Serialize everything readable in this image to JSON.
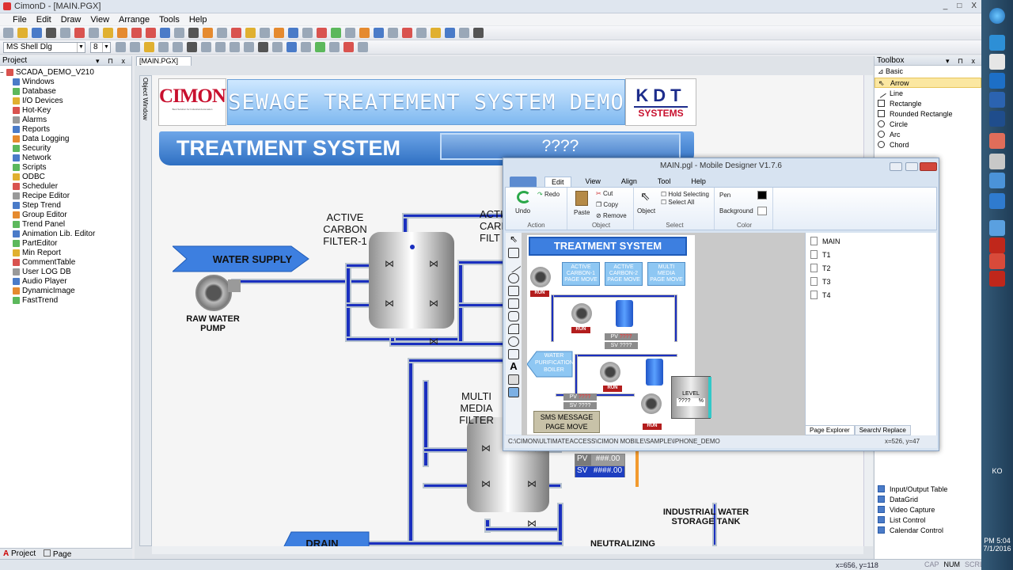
{
  "window": {
    "title": "CimonD - [MAIN.PGX]",
    "controls": [
      "_",
      "□",
      "X"
    ]
  },
  "menu": [
    "File",
    "Edit",
    "Draw",
    "View",
    "Arrange",
    "Tools",
    "Help"
  ],
  "font_toolbar": {
    "font_name": "MS Shell Dlg",
    "font_size": "8"
  },
  "project": {
    "header": "Project",
    "root": "SCADA_DEMO_V210",
    "items": [
      "Windows",
      "Database",
      "I/O Devices",
      "Hot-Key",
      "Alarms",
      "Reports",
      "Data Logging",
      "Security",
      "Network",
      "Scripts",
      "ODBC",
      "Scheduler",
      "Recipe Editor",
      "Step Trend",
      "Group Editor",
      "Trend Panel",
      "Animation Lib. Editor",
      "PartEditor",
      "Min Report",
      "CommentTable",
      "User LOG DB",
      "Audio Player",
      "DynamicImage",
      "FastTrend"
    ],
    "tabs": [
      "Project",
      "Page"
    ]
  },
  "editor": {
    "doc_tab": "[MAIN.PGX]",
    "object_window": "Object Window"
  },
  "scada": {
    "logo_left": "CIMON",
    "logo_left_sub": "Best Solution for Industrial Automation",
    "banner": "SEWAGE TREATEMENT SYSTEM DEMO",
    "logo_right_top": "KDT",
    "logo_right_bottom": "SYSTEMS",
    "treatment_title": "TREATMENT SYSTEM",
    "treatment_value": "????",
    "water_supply": "WATER SUPPLY",
    "raw_pump": "RAW WATER\nPUMP",
    "acf1": "ACTIVE\nCARBON\nFILTER-1",
    "acf2_partial": "ACTI\nCARB\nFILT",
    "multi": "MULTI\nMEDIA\nFILTER",
    "industrial": "INDUSTRIAL WATER\nSTORAGE TANK",
    "neutral": "NEUTRALIZING AGENT",
    "drain": "DRAIN",
    "pv_label": "PV",
    "pv_value": "###.00",
    "sv_label": "SV",
    "sv_value": "####.00"
  },
  "toolbox": {
    "header": "Toolbox",
    "group": "Basic",
    "items": [
      "Arrow",
      "Line",
      "Rectangle",
      "Rounded Rectangle",
      "Circle",
      "Arc",
      "Chord"
    ],
    "bottom_items": [
      "Input/Output Table",
      "DataGrid",
      "Video Capture",
      "List Control",
      "Calendar Control"
    ]
  },
  "status": {
    "coords": "x=656, y=118",
    "caps": "CAP",
    "num": "NUM",
    "scrl": "SCRL"
  },
  "taskbar": {
    "lang": "KO",
    "time": "PM 5:04",
    "date": "7/1/2016"
  },
  "dialog": {
    "title": "MAIN.pgl - Mobile Designer V1.7.6",
    "tabs": [
      "Edit",
      "View",
      "Align",
      "Tool",
      "Help"
    ],
    "ribbon": {
      "undo": "Undo",
      "redo": "Redo",
      "action": "Action",
      "paste": "Paste",
      "cut": "Cut",
      "copy": "Copy",
      "remove": "Remove",
      "object_group": "Object",
      "object_btn": "Object",
      "hold": "Hold Selecting",
      "select_all": "Select All",
      "select": "Select",
      "pen": "Pen",
      "background": "Background",
      "color": "Color"
    },
    "pages": [
      "MAIN",
      "T1",
      "T2",
      "T3",
      "T4"
    ],
    "page_tabs": [
      "Page Explorer",
      "Search/ Replace"
    ],
    "status_path": "C:\\CIMON\\ULTIMATEACCESS\\CIMON MOBILE\\SAMPLE\\IPHONE_DEMO",
    "status_xy": "x=526, y=47",
    "mobile": {
      "title": "TREATMENT SYSTEM",
      "btn1": "ACTIVE\nCARBON-1\nPAGE MOVE",
      "btn2": "ACTIVE\nCARBON-2\nPAGE MOVE",
      "btn3": "MULTI\nMEDIA\nPAGE MOVE",
      "run": "RUN",
      "pv": "PV",
      "sv": "SV",
      "val": "????",
      "boiler": "WATER\nPURIFICATION\nBOILER",
      "sms": "SMS MESSAGE\nPAGE MOVE",
      "level": "LEVEL",
      "pct": "%"
    }
  }
}
